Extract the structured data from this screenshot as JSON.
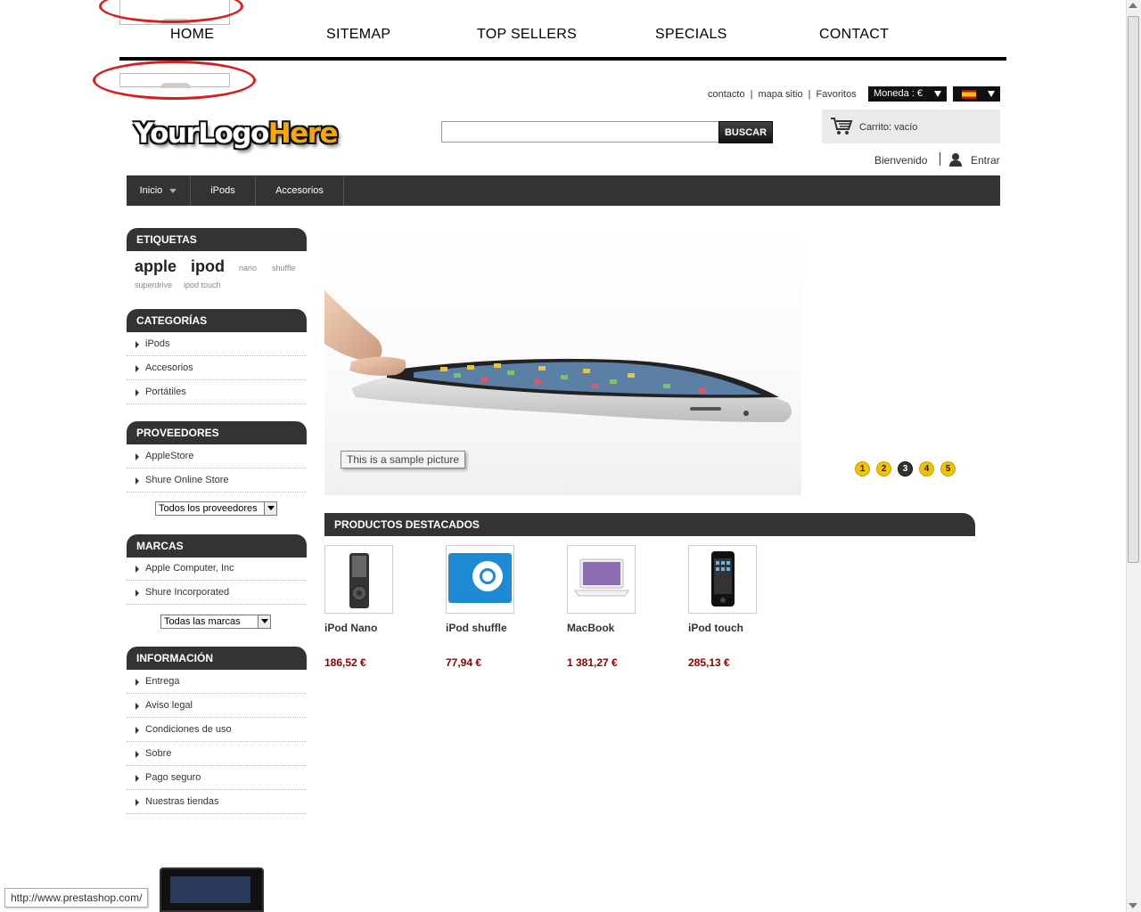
{
  "top_nav": [
    "HOME",
    "SITEMAP",
    "TOP SELLERS",
    "SPECIALS",
    "CONTACT"
  ],
  "header_links": [
    "contacto",
    "mapa sitio",
    "Favoritos"
  ],
  "currency": "Moneda : €",
  "logo": {
    "part1": "YourLogo",
    "part2": "Here"
  },
  "search": {
    "button": "BUSCAR",
    "value": ""
  },
  "cart": {
    "label": "Carrito: vacío"
  },
  "user": {
    "welcome": "Bienvenido",
    "login": "Entrar"
  },
  "menu": [
    "Inicio",
    "iPods",
    "Accesorios"
  ],
  "tags": {
    "title": "ETIQUETAS",
    "items": [
      "apple",
      "ipod",
      "nano",
      "shuffle",
      "superdrive",
      "ipod touch"
    ]
  },
  "categories": {
    "title": "CATEGORÍAS",
    "items": [
      "iPods",
      "Accesorios",
      "Portátiles"
    ]
  },
  "suppliers": {
    "title": "PROVEEDORES",
    "items": [
      "AppleStore",
      "Shure Online Store"
    ],
    "select": "Todos los proveedores"
  },
  "brands": {
    "title": "MARCAS",
    "items": [
      "Apple Computer, Inc",
      "Shure Incorporated"
    ],
    "select": "Todas las marcas"
  },
  "info": {
    "title": "INFORMACIÓN",
    "items": [
      "Entrega",
      "Aviso legal",
      "Condiciones de uso",
      "Sobre",
      "Pago seguro",
      "Nuestras tiendas"
    ]
  },
  "slider": {
    "caption": "This is a sample picture",
    "pages": [
      "1",
      "2",
      "3",
      "4",
      "5"
    ],
    "active_page": "3"
  },
  "featured": {
    "title": "PRODUCTOS DESTACADOS",
    "products": [
      {
        "name": "iPod Nano",
        "price": "186,52 €"
      },
      {
        "name": "iPod shuffle",
        "price": "77,94 €"
      },
      {
        "name": "MacBook",
        "price": "1 381,27 €"
      },
      {
        "name": "iPod touch",
        "price": "285,13 €"
      }
    ]
  },
  "status_url": "http://www.prestashop.com/",
  "colors": {
    "accent_red": "#d62020",
    "dark": "#333333",
    "price": "#8b0000",
    "pager": "#f2c200"
  }
}
